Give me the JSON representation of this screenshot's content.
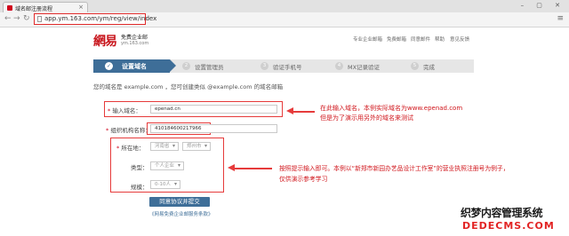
{
  "browser": {
    "tab_title": "域名邮注册流程",
    "tab_close": "×",
    "window_controls": "– ▢ ✕",
    "url": "app.ym.163.com/ym/reg/view/index"
  },
  "header": {
    "logo": "網易",
    "logo_sub": "免费企业邮",
    "logo_url": "ym.163.com",
    "nav": [
      "专业企业邮箱",
      "免费邮箱",
      "同意邮件",
      "帮助",
      "意见反馈"
    ]
  },
  "steps": [
    {
      "num": "✓",
      "label": "设置域名",
      "active": true
    },
    {
      "num": "2",
      "label": "设置管理员"
    },
    {
      "num": "3",
      "label": "验证手机号"
    },
    {
      "num": "4",
      "label": "MX记录验证"
    },
    {
      "num": "5",
      "label": "完成"
    }
  ],
  "intro": "您的域名是 example.com ，您可创建类似 @example.com 的域名邮箱",
  "form": {
    "domain_label": "输入域名：",
    "domain_value": "epenad.cn",
    "org_label": "组织机构名称：",
    "org_value": "410184600217966",
    "location_label": "所在地：",
    "province_value": "河南省",
    "city_value": "郑州市",
    "type_label": "类型：",
    "type_value": "个人企业",
    "size_label": "规模：",
    "size_value": "0-10人",
    "submit_label": "同意协议并提交",
    "agree_link": "《网易免费企业邮服务条款》"
  },
  "annotations": {
    "note1_line1": "在此输入域名，本例实际域名为www.epenad.com",
    "note1_line2": "但是为了演示用另外的域名来测试",
    "note2_line1": "按照提示输入即可。本例以“新郑市新园办艺品设计工作室”的营业执照注册号为例子，",
    "note2_line2": "仅供演示参考学习"
  },
  "watermark": {
    "line1": "织梦内容管理系统",
    "line2": "DEDECMS.COM"
  }
}
